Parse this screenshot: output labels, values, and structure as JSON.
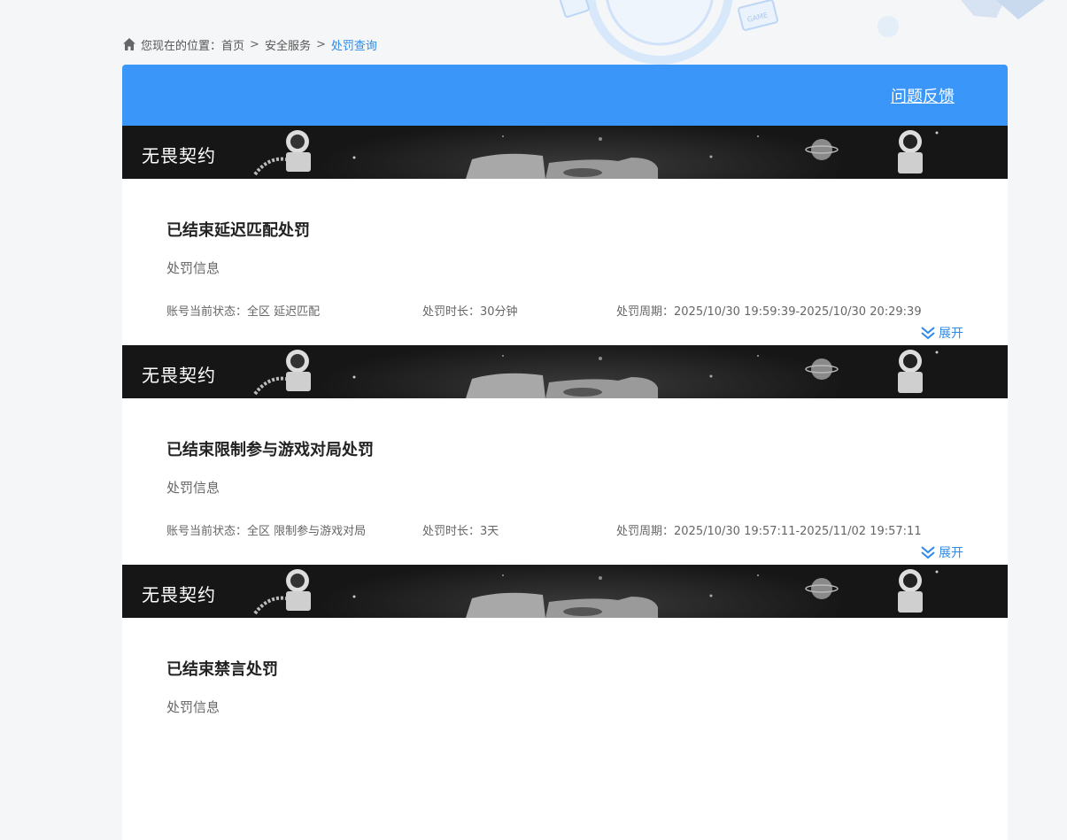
{
  "breadcrumb": {
    "prefix": "您现在的位置：",
    "items": [
      "首页",
      "安全服务"
    ],
    "separator": ">",
    "current": "处罚查询"
  },
  "header": {
    "feedback_label": "问题反馈"
  },
  "cards": [
    {
      "banner_title": "无畏契约",
      "title": "已结束延迟匹配处罚",
      "subtitle": "处罚信息",
      "status_label": "账号当前状态：",
      "status_value": "全区 延迟匹配",
      "duration_label": "处罚时长：",
      "duration_value": "30分钟",
      "period_label": "处罚周期：",
      "period_value": "2025/10/30 19:59:39-2025/10/30 20:29:39",
      "expand_label": "展开"
    },
    {
      "banner_title": "无畏契约",
      "title": "已结束限制参与游戏对局处罚",
      "subtitle": "处罚信息",
      "status_label": "账号当前状态：",
      "status_value": "全区 限制参与游戏对局",
      "duration_label": "处罚时长：",
      "duration_value": "3天",
      "period_label": "处罚周期：",
      "period_value": "2025/10/30 19:57:11-2025/11/02 19:57:11",
      "expand_label": "展开"
    },
    {
      "banner_title": "无畏契约",
      "title": "已结束禁言处罚",
      "subtitle": "处罚信息"
    }
  ],
  "colors": {
    "accent": "#3a96f8",
    "link": "#2e8ae6",
    "banner_bg": "#161616"
  }
}
